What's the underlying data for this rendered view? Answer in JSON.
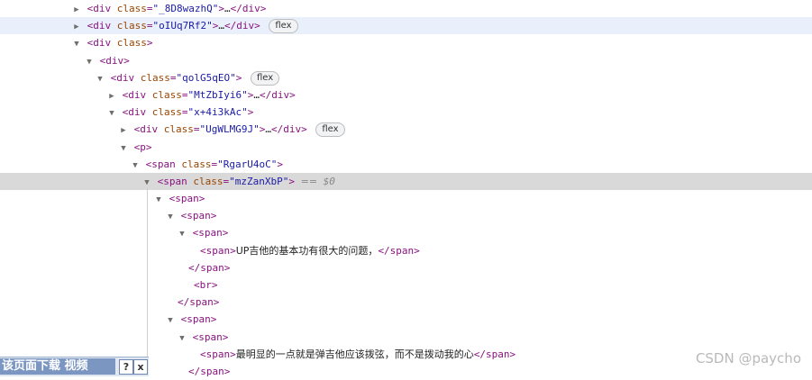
{
  "elements": {
    "r1": {
      "open": "<div",
      "attr": "class",
      "val": "\"_8D8wazhQ\"",
      "close": ">",
      "ell": "…",
      "end": "</div>"
    },
    "r2": {
      "open": "<div",
      "attr": "class",
      "val": "\"oIUq7Rf2\"",
      "close": ">",
      "ell": "…",
      "end": "</div>",
      "badge": "flex"
    },
    "r3": {
      "open": "<div",
      "attr": "class",
      "close": ">"
    },
    "r4": {
      "text": "<div>"
    },
    "r5": {
      "open": "<div",
      "attr": "class",
      "val": "\"qolG5qEO\"",
      "close": ">",
      "badge": "flex"
    },
    "r6": {
      "open": "<div",
      "attr": "class",
      "val": "\"MtZbIyi6\"",
      "close": ">",
      "ell": "…",
      "end": "</div>"
    },
    "r7": {
      "open": "<div",
      "attr": "class",
      "val": "\"x+4i3kAc\"",
      "close": ">"
    },
    "r8": {
      "open": "<div",
      "attr": "class",
      "val": "\"UgWLMG9J\"",
      "close": ">",
      "ell": "…",
      "end": "</div>",
      "badge": "flex"
    },
    "r9": {
      "text": "<p>"
    },
    "r10": {
      "open": "<span",
      "attr": "class",
      "val": "\"RgarU4oC\"",
      "close": ">"
    },
    "r11": {
      "open": "<span",
      "attr": "class",
      "val": "\"mzZanXbP\"",
      "close": ">",
      "eq": "==",
      "dollar": "$0"
    },
    "r12": {
      "text": "<span>"
    },
    "r13": {
      "text": "<span>"
    },
    "r14": {
      "text": "<span>"
    },
    "r15": {
      "open": "<span>",
      "content": "UP吉他的基本功有很大的问题，",
      "end": "</span>"
    },
    "r16": {
      "text": "</span>"
    },
    "r17": {
      "text": "<br>"
    },
    "r18": {
      "text": "</span>"
    },
    "r19": {
      "text": "<span>"
    },
    "r20": {
      "text": "<span>"
    },
    "r21": {
      "open": "<span>",
      "content": "最明显的一点就是弹吉他应该拨弦，而不是拨动我的心",
      "end": "</span>"
    },
    "r22": {
      "text": "</span>"
    }
  },
  "download_bar": {
    "label": "该页面下载 视频",
    "help": "?",
    "close": "x"
  },
  "watermark": "CSDN @paycho"
}
